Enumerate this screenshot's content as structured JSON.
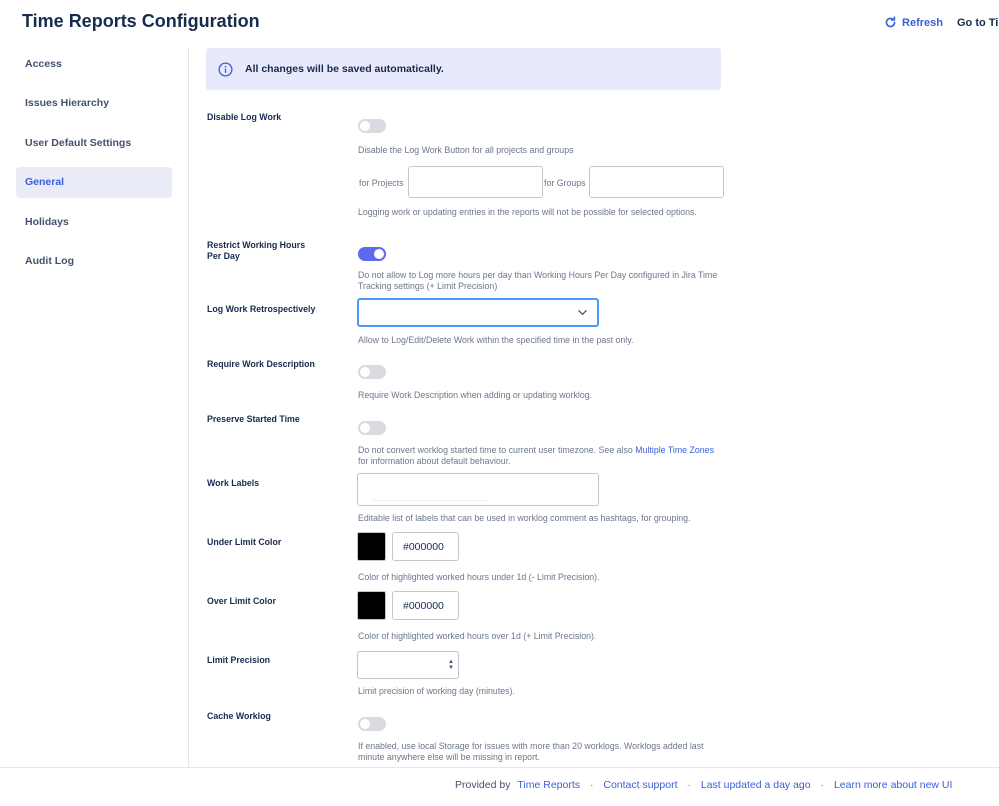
{
  "header": {
    "title": "Time Reports Configuration",
    "refresh_label": "Refresh",
    "goto_label": "Go to Tim"
  },
  "sidebar": {
    "items": [
      {
        "label": "Access"
      },
      {
        "label": "Issues Hierarchy"
      },
      {
        "label": "User Default Settings"
      },
      {
        "label": "General",
        "active": true
      },
      {
        "label": "Holidays"
      },
      {
        "label": "Audit Log"
      }
    ]
  },
  "banner": {
    "text": "All changes will be saved automatically.",
    "icon": "info-icon"
  },
  "settings": {
    "disable_log_work": {
      "label": "Disable Log Work",
      "enabled": false,
      "description": "Disable the Log Work Button for all projects and groups",
      "projects_label": "for Projects",
      "projects_value": "",
      "groups_label": "for Groups",
      "groups_value": "",
      "note": "Logging work or updating entries in the reports will not be possible for selected options."
    },
    "restrict_working_hours": {
      "label": "Restrict Working Hours Per Day",
      "enabled": true,
      "description": "Do not allow to Log more hours per day than Working Hours Per Day configured in Jira Time Tracking settings (+ Limit Precision)"
    },
    "log_work_retrospectively": {
      "label": "Log Work Retrospectively",
      "selected": "",
      "description": "Allow to Log/Edit/Delete Work within the specified time in the past only."
    },
    "require_work_description": {
      "label": "Require Work Description",
      "enabled": false,
      "description": "Require Work Description when adding or updating worklog."
    },
    "preserve_started_time": {
      "label": "Preserve Started Time",
      "enabled": false,
      "description": "Do not convert worklog started time to current user timezone. See also",
      "link": "Multiple Time Zones",
      "description_after": "for information about default behaviour."
    },
    "work_labels": {
      "label": "Work Labels",
      "value": "",
      "description": "Editable list of labels that can be used in worklog comment as hashtags, for grouping."
    },
    "under_limit_color": {
      "label": "Under Limit Color",
      "color": "#000000",
      "value": "#000000",
      "description": "Color of highlighted worked hours under 1d (- Limit Precision)."
    },
    "over_limit_color": {
      "label": "Over Limit Color",
      "color": "#000000",
      "value": "#000000",
      "description": "Color of highlighted worked hours over 1d (+ Limit Precision)."
    },
    "limit_precision": {
      "label": "Limit Precision",
      "value": "",
      "description": "Limit precision of working day (minutes)."
    },
    "cache_worklog": {
      "label": "Cache Worklog",
      "enabled": false,
      "description": "If enabled, use local Storage for issues with more than 20 worklogs. Worklogs added last minute anywhere else will be missing in report."
    }
  },
  "footer": {
    "provided_by": "Provided by",
    "brand_link": "Time Reports",
    "support_link": "Contact support",
    "updated_link": "Last updated a day ago",
    "learn_link": "Learn more about new UI",
    "separator": "·"
  },
  "colors": {
    "accent": "#3a5fd8",
    "toggle_on": "#5b6bf0",
    "toggle_off": "#d9dbe1",
    "banner_bg": "#e8e9fb",
    "active_nav_bg": "#e9ecf7",
    "focus_border": "#4c9aff"
  }
}
